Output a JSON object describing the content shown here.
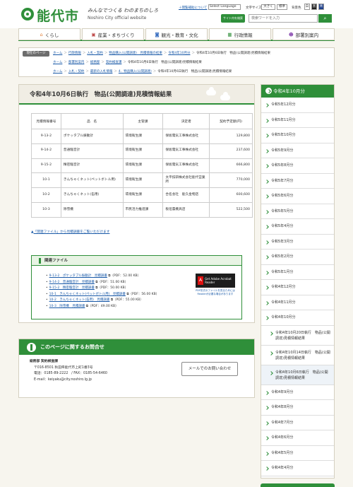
{
  "header": {
    "logo_text": "能代市",
    "tagline": "みんなでつくる わのまちのしろ",
    "subtitle": "Noshiro City official website",
    "browsing_assist_link": "＋閲覧補助について",
    "language_select": "Select Language",
    "font_size_label": "文字サイズ",
    "font_size_larger": "大きく",
    "font_size_standard": "標準",
    "bg_color_label": "背景色",
    "bg_color_options": [
      "白",
      "黒",
      "青"
    ],
    "search_label": "サイト内を検索",
    "search_placeholder": "検索ワードを入力",
    "search_button_icon": "search-icon"
  },
  "nav": [
    {
      "label": "くらし",
      "icon": "home-icon"
    },
    {
      "label": "産業・まちづくり",
      "icon": "briefcase-icon"
    },
    {
      "label": "観光・教育・文化",
      "icon": "camera-icon"
    },
    {
      "label": "行政情報",
      "icon": "grid-icon"
    },
    {
      "label": "部署別案内",
      "icon": "people-icon"
    }
  ],
  "breadcrumb": {
    "label": "現在のページ",
    "rows": [
      [
        "ホーム",
        "行政情報",
        "入札・契約",
        "物品購入(公開調達)　見積情報の結果",
        "令和4年10月分",
        "令和4年10月6日執行　物品(公開調達)見積情報結果"
      ],
      [
        "ホーム",
        "部署別案内",
        "総務部",
        "契約検査課",
        "令和4年10月6日執行　物品(公開調達)見積情報結果"
      ],
      [
        "ホーム",
        "入札・契約",
        "最新の入札情報",
        "4．物品購入(公開調達)",
        "令和4年10月6日執行　物品(公開調達)見積情報結果"
      ]
    ]
  },
  "page_title": "令和4年10月6日執行　物品(公開調達)見積情報結果",
  "table": {
    "headers": [
      "見積情報番号",
      "品　名",
      "主管課",
      "決定者",
      "契約予定額(円)"
    ],
    "rows": [
      [
        "9-13-2",
        "ポケッタブル振動計",
        "環境衛生課",
        "保坂電気工事株式会社",
        "129,800"
      ],
      [
        "9-14-2",
        "普通騒音計",
        "環境衛生課",
        "保坂電気工事株式会社",
        "237,600"
      ],
      [
        "9-15-2",
        "精密騒音計",
        "環境衛生課",
        "保坂電気工事株式会社",
        "666,800"
      ],
      [
        "10-1",
        "きんちゃくネット(ペットボトル用)",
        "環境衛生課",
        "太平技研株式会社能代営業所",
        "770,000"
      ],
      [
        "10-2",
        "きんちゃくネット(缶用)",
        "環境衛生課",
        "合名会社　能久金物店",
        "600,600"
      ],
      [
        "10-3",
        "除雪機",
        "市民活力推進課",
        "板垣農機具店",
        "522,500"
      ]
    ]
  },
  "note_link": "「関連ファイル」から見積調書をご覧いただけます",
  "related": {
    "heading": "関連ファイル",
    "files": [
      {
        "link": "9-13-2　ポケッタブル振動計　見積調書",
        "meta": "（PDF：52.00 KB）"
      },
      {
        "link": "9-14-2　普通騒音計　見積調書",
        "meta": "（PDF：51.00 KB）"
      },
      {
        "link": "9-15-2　精密騒音計　見積調書",
        "meta": "（PDF：50.00 KB）"
      },
      {
        "link": "10-1　きんちゃくネット(ペットボトル用)　見積調書",
        "meta": "（PDF：56.00 KB）"
      },
      {
        "link": "10-2　きんちゃくネット(缶用)　見積調書",
        "meta": "（PDF：55.00 KB）"
      },
      {
        "link": "10-3　除雪機　見積調書",
        "meta": "（PDF：49.00 KB）"
      }
    ],
    "acrobat_button": "Get Adobe Acrobat Reader",
    "acrobat_note": "PDF形式のファイルを見るためにはReaderが必要な場合があります"
  },
  "contact": {
    "heading": "このページに関するお問合せ",
    "dept": "総務部 契約検査課",
    "address": "〒016-8501 秋田県能代市上町1番3号",
    "phone": "電話：0185-89-2222　/ FAX：0185-54-6460",
    "email": "E-mail：keiyaku@city.noshiro.lg.jp",
    "button": "メールでのお問い合わせ"
  },
  "sidebar": {
    "heading": "令和4年10月分",
    "items_top": [
      "令和5年12月分",
      "令和5年11月分",
      "令和5年10月分",
      "令和5年9月分",
      "令和5年8月分",
      "令和5年7月分",
      "令和5年6月分",
      "令和5年5月分",
      "令和5年4月分",
      "令和5年3月分",
      "令和5年2月分",
      "令和5年1月分",
      "令和4年12月分",
      "令和4年11月分",
      "令和4年10月分"
    ],
    "sub_items": [
      "令和4年10月20日執行　物品(公開調達)見積情報結果",
      "令和4年10月14日執行　物品(公開調達)見積情報結果",
      "令和4年10月6日執行　物品(公開調達)見積情報結果"
    ],
    "items_bottom": [
      "令和4年9月分",
      "令和4年8月分",
      "令和4年7月分",
      "令和4年6月分",
      "令和4年5月分",
      "令和4年4月分"
    ]
  },
  "colors": {
    "brand_green": "#2f8f3a",
    "link_blue": "#1a5aa8"
  }
}
